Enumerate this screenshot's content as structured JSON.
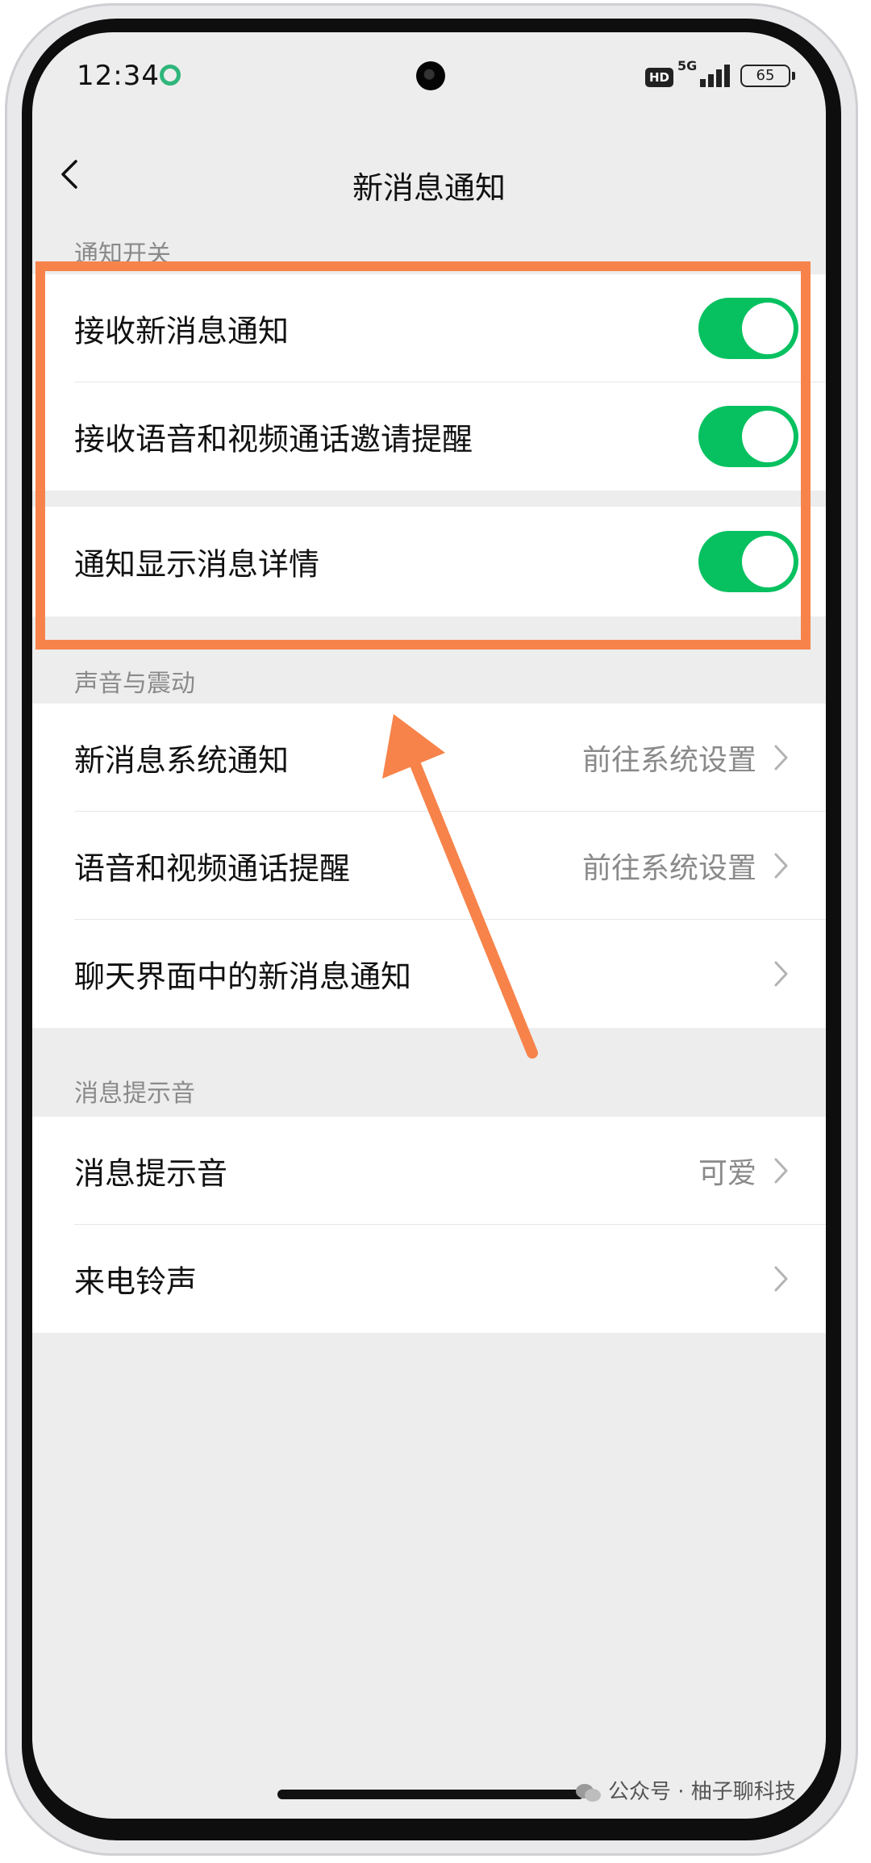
{
  "status_bar": {
    "time": "12:34",
    "network": "5G",
    "hd_badge": "HD",
    "battery": "65"
  },
  "header": {
    "title": "新消息通知",
    "back_icon": "chevron-left-icon"
  },
  "sections": {
    "notification_switch": {
      "label": "通知开关",
      "items": [
        {
          "label": "接收新消息通知",
          "enabled": true
        },
        {
          "label": "接收语音和视频通话邀请提醒",
          "enabled": true
        },
        {
          "label": "通知显示消息详情",
          "enabled": true
        }
      ]
    },
    "sound_vibration": {
      "label": "声音与震动",
      "items": [
        {
          "label": "新消息系统通知",
          "value": "前往系统设置"
        },
        {
          "label": "语音和视频通话提醒",
          "value": "前往系统设置"
        },
        {
          "label": "聊天界面中的新消息通知",
          "value": ""
        }
      ]
    },
    "message_tone": {
      "label": "消息提示音",
      "items": [
        {
          "label": "消息提示音",
          "value": "可爱"
        },
        {
          "label": "来电铃声",
          "value": ""
        }
      ]
    }
  },
  "annotation": {
    "highlight_color": "#f7834a"
  },
  "watermark": "公众号 · 柚子聊科技",
  "colors": {
    "toggle_on": "#07c160",
    "background": "#ededed"
  }
}
